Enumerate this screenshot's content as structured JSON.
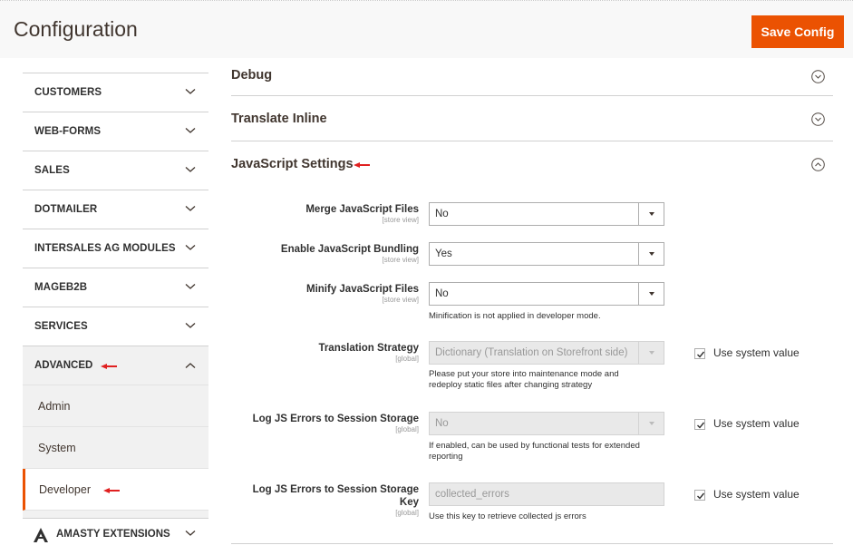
{
  "header": {
    "title": "Configuration",
    "save_label": "Save Config"
  },
  "sidebar": {
    "items": [
      {
        "label": "CUSTOMERS"
      },
      {
        "label": "WEB-FORMS"
      },
      {
        "label": "SALES"
      },
      {
        "label": "DOTMAILER"
      },
      {
        "label": "INTERSALES AG MODULES"
      },
      {
        "label": "MAGEB2B"
      },
      {
        "label": "SERVICES"
      }
    ],
    "advanced": {
      "label": "ADVANCED",
      "children": [
        {
          "label": "Admin"
        },
        {
          "label": "System"
        },
        {
          "label": "Developer",
          "active": true
        }
      ]
    },
    "amasty": {
      "label": "AMASTY EXTENSIONS"
    }
  },
  "sections": {
    "debug": "Debug",
    "translate_inline": "Translate Inline",
    "javascript": "JavaScript Settings"
  },
  "fields": {
    "merge": {
      "label": "Merge JavaScript Files",
      "scope": "[store view]",
      "value": "No"
    },
    "bundling": {
      "label": "Enable JavaScript Bundling",
      "scope": "[store view]",
      "value": "Yes"
    },
    "minify": {
      "label": "Minify JavaScript Files",
      "scope": "[store view]",
      "value": "No",
      "note": "Minification is not applied in developer mode."
    },
    "strategy": {
      "label": "Translation Strategy",
      "scope": "[global]",
      "value": "Dictionary (Translation on Storefront side)",
      "note_line1": "Please put your store into maintenance mode and",
      "note_line2": "redeploy static files after changing strategy",
      "use_system": "Use system value"
    },
    "log_errors": {
      "label": "Log JS Errors to Session Storage",
      "scope": "[global]",
      "value": "No",
      "note_line1": "If enabled, can be used by functional tests for extended",
      "note_line2": "reporting",
      "use_system": "Use system value"
    },
    "log_key": {
      "label": "Log JS Errors to Session Storage Key",
      "scope": "[global]",
      "value": "collected_errors",
      "note": "Use this key to retrieve collected js errors",
      "use_system": "Use system value"
    }
  },
  "colors": {
    "accent": "#eb5202",
    "annotation_arrow": "#e02020"
  }
}
